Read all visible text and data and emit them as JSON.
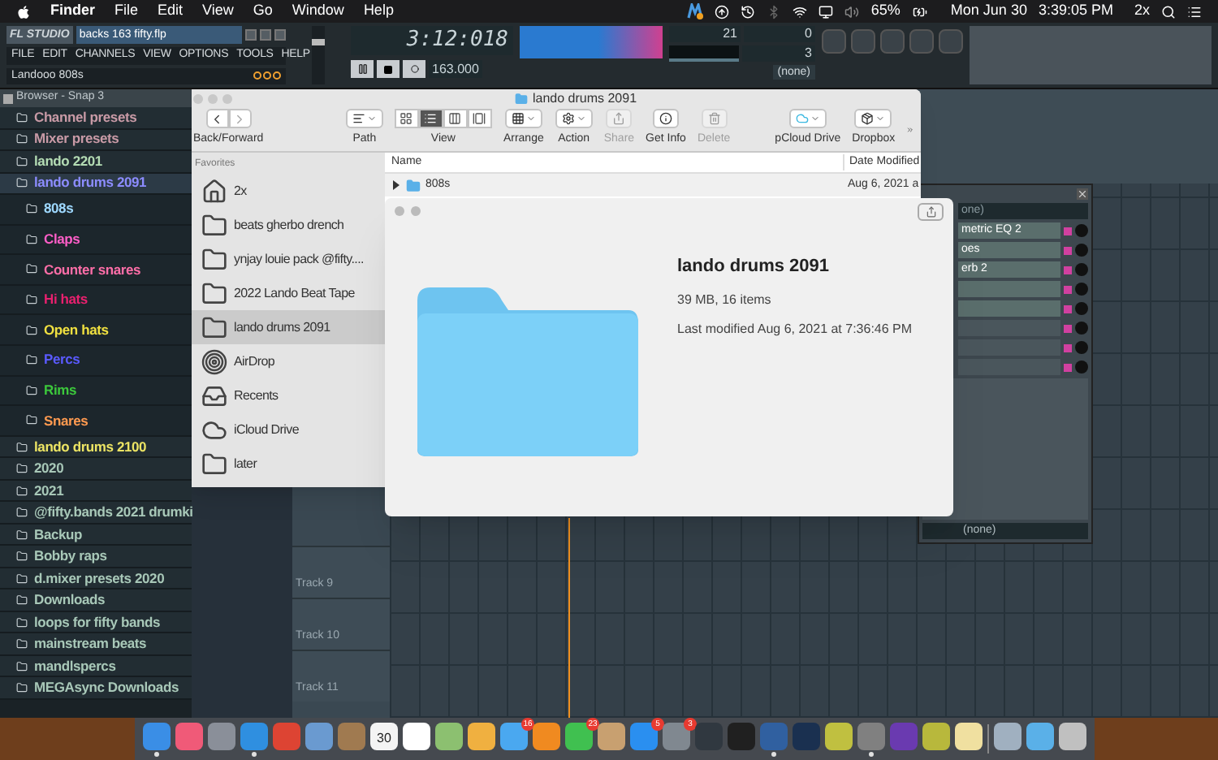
{
  "menu_bar": {
    "app": "Finder",
    "menus": [
      "File",
      "Edit",
      "View",
      "Go",
      "Window",
      "Help"
    ],
    "battery": "65%",
    "date": "Mon Jun 30",
    "time": "3:39:05 PM",
    "user": "2x"
  },
  "fl_studio": {
    "logo": "FL STUDIO",
    "project": "backs 163 fifty.flp",
    "menus": [
      "FILE",
      "EDIT",
      "CHANNELS",
      "VIEW",
      "OPTIONS",
      "TOOLS",
      "HELP"
    ],
    "hint": "Landooo 808s",
    "song_time": "3:12:018",
    "tempo": "163.000",
    "master_slider": {
      "level": 0.75
    },
    "cpu": "21",
    "polyphony": "0",
    "memory": "3",
    "pattern_selector": "(none)"
  },
  "browser": {
    "title": "Browser - Snap 3",
    "items": [
      {
        "label": "Channel presets",
        "color": "#c89aa6",
        "selected": false
      },
      {
        "label": "Mixer presets",
        "color": "#c89aa6",
        "selected": false
      },
      {
        "label": "lando 2201",
        "color": "#b4dcb4",
        "selected": false
      },
      {
        "label": "lando drums 2091",
        "color": "#8c8cff",
        "selected": true,
        "children": [
          {
            "label": "808s",
            "color": "#9ed8ff",
            "selected": false
          },
          {
            "label": "Claps",
            "color": "#ff5ec8",
            "selected": false
          },
          {
            "label": "Counter snares",
            "color": "#ff6ea8",
            "selected": false
          },
          {
            "label": "Hi hats",
            "color": "#e8206e",
            "selected": false
          },
          {
            "label": "Open hats",
            "color": "#f0e040",
            "selected": false
          },
          {
            "label": "Percs",
            "color": "#5a5aff",
            "selected": false
          },
          {
            "label": "Rims",
            "color": "#3cc83c",
            "selected": false
          },
          {
            "label": "Snares",
            "color": "#ff9a50",
            "selected": false
          }
        ]
      },
      {
        "label": "lando drums 2100",
        "color": "#ece464",
        "selected": false
      },
      {
        "label": "2020",
        "color": "#a8c8b8",
        "selected": false
      },
      {
        "label": "2021",
        "color": "#a8c8b8",
        "selected": false
      },
      {
        "label": "@fifty.bands 2021 drumki",
        "color": "#a8c8b8",
        "selected": false
      },
      {
        "label": "Backup",
        "color": "#a8c8b8",
        "selected": false
      },
      {
        "label": "Bobby raps",
        "color": "#a8c8b8",
        "selected": false
      },
      {
        "label": "d.mixer presets 2020",
        "color": "#a8c8b8",
        "selected": false
      },
      {
        "label": "Downloads",
        "color": "#a8c8b8",
        "selected": false
      },
      {
        "label": "loops for fifty bands",
        "color": "#a8c8b8",
        "selected": false
      },
      {
        "label": "mainstream beats",
        "color": "#a8c8b8",
        "selected": false
      },
      {
        "label": "mandlspercs",
        "color": "#a8c8b8",
        "selected": false
      },
      {
        "label": "MEGAsync Downloads",
        "color": "#a8c8b8",
        "selected": false
      }
    ]
  },
  "playlist": {
    "tracks": [
      "Track 9",
      "Track 10",
      "Track 11"
    ]
  },
  "mixer": {
    "top_selector": "one)",
    "slots": [
      "metric EQ 2",
      "oes",
      "erb 2"
    ],
    "bottom_selector": "(none)"
  },
  "finder": {
    "title": "lando drums 2091",
    "toolbar": [
      {
        "label": "Back/Forward",
        "kind": "nav",
        "disabled": false
      },
      {
        "label": "Path",
        "kind": "path",
        "disabled": false
      },
      {
        "label": "View",
        "kind": "view",
        "disabled": false,
        "segments": [
          {
            "kind": "icons",
            "selected": false
          },
          {
            "kind": "list",
            "selected": true
          },
          {
            "kind": "columns",
            "selected": false
          },
          {
            "kind": "gallery",
            "selected": false
          }
        ]
      },
      {
        "label": "Arrange",
        "kind": "arrange",
        "disabled": false
      },
      {
        "label": "Action",
        "kind": "action",
        "disabled": false
      },
      {
        "label": "Share",
        "kind": "share",
        "disabled": true
      },
      {
        "label": "Get Info",
        "kind": "info",
        "disabled": false
      },
      {
        "label": "Delete",
        "kind": "delete",
        "disabled": true
      },
      {
        "label": "pCloud Drive",
        "kind": "cloud",
        "disabled": false
      },
      {
        "label": "Dropbox",
        "kind": "dropbox",
        "disabled": false
      }
    ],
    "sidebar_heading": "Favorites",
    "sidebar": [
      {
        "label": "2x",
        "kind": "home",
        "selected": false
      },
      {
        "label": "beats gherbo drench",
        "kind": "folder",
        "selected": false
      },
      {
        "label": "ynjay louie pack @fifty....",
        "kind": "folder",
        "selected": false
      },
      {
        "label": "2022 Lando Beat Tape",
        "kind": "folder",
        "selected": false
      },
      {
        "label": "lando drums 2091",
        "kind": "folder",
        "selected": true
      },
      {
        "label": "AirDrop",
        "kind": "airdrop",
        "selected": false
      },
      {
        "label": "Recents",
        "kind": "recents",
        "selected": false
      },
      {
        "label": "iCloud Drive",
        "kind": "cloud",
        "selected": false
      },
      {
        "label": "later",
        "kind": "folder",
        "selected": false
      }
    ],
    "columns": [
      "Name",
      "Date Modified"
    ],
    "rows": [
      {
        "name": "808s",
        "date": "Aug 6, 2021 a"
      }
    ]
  },
  "quick_look": {
    "title": "lando drums 2091",
    "size": "39 MB, 16 items",
    "modified": "Last modified Aug 6, 2021 at 7:36:46 PM"
  },
  "dock": {
    "apps": [
      {
        "color": "#3a8ee6",
        "running": true
      },
      {
        "color": "#f05a78",
        "running": false
      },
      {
        "color": "#8a8f99",
        "running": false
      },
      {
        "color": "#2f8fe0",
        "running": true
      },
      {
        "color": "#dd4433",
        "running": false
      },
      {
        "color": "#6a9ad0",
        "running": false
      },
      {
        "color": "#a07a50",
        "running": false
      },
      {
        "color": "#f4f4f4",
        "running": false,
        "text": "30"
      },
      {
        "color": "#ffffff",
        "running": false
      },
      {
        "color": "#8cc070",
        "running": false
      },
      {
        "color": "#f0b040",
        "running": false
      },
      {
        "color": "#4aa8f0",
        "running": false,
        "badge": "16"
      },
      {
        "color": "#f08a20",
        "running": false
      },
      {
        "color": "#40c050",
        "running": false,
        "badge": "23"
      },
      {
        "color": "#c8a070",
        "running": false
      },
      {
        "color": "#2a8ff0",
        "running": false,
        "badge": "5"
      },
      {
        "color": "#808890",
        "running": false,
        "badge": "3"
      },
      {
        "color": "#303840",
        "running": false
      },
      {
        "color": "#202020",
        "running": false
      },
      {
        "color": "#3060a0",
        "running": true
      },
      {
        "color": "#1a3050",
        "running": false
      },
      {
        "color": "#c0c040",
        "running": false
      },
      {
        "color": "#808080",
        "running": true
      },
      {
        "color": "#6a3ab0",
        "running": false
      },
      {
        "color": "#b8b83c",
        "running": false
      },
      {
        "color": "#f0e0a0",
        "running": false
      },
      {
        "color": "#a0b0c0",
        "running": false
      },
      {
        "color": "#5ab0e8",
        "running": false
      },
      {
        "color": "#c0c0c0",
        "running": false
      }
    ]
  }
}
